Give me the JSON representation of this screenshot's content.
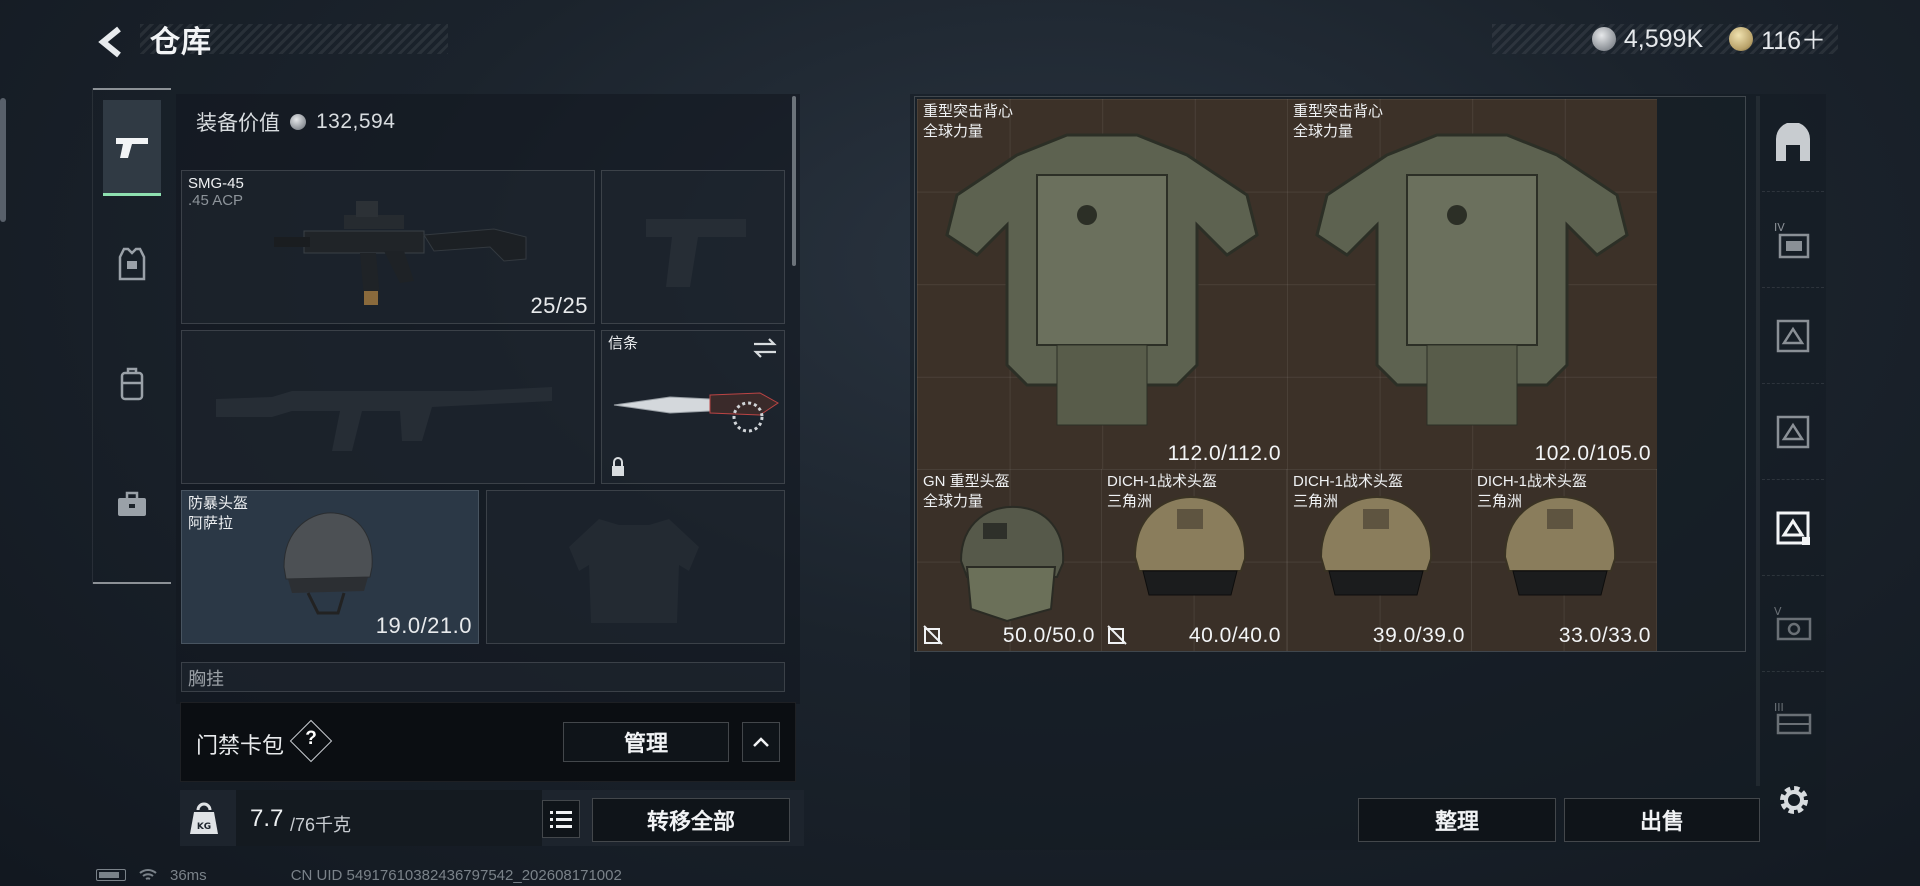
{
  "header": {
    "title": "仓库",
    "silver_amount": "4,599K",
    "gold_amount": "116＋"
  },
  "left_rail": [
    {
      "icon": "pistol-icon",
      "active": true
    },
    {
      "icon": "armor-vest-icon"
    },
    {
      "icon": "backpack-icon"
    },
    {
      "icon": "briefcase-icon"
    }
  ],
  "equipment": {
    "value_label": "装备价值",
    "value": "132,594",
    "primary_weapon": {
      "name": "SMG-45",
      "ammo": ".45 ACP",
      "count": "25/25"
    },
    "knife": {
      "name": "信条",
      "locked": true
    },
    "helmet": {
      "name": "防暴头盔",
      "sub": "阿萨拉",
      "durability": "19.0/21.0"
    },
    "next_section_label": "胸挂",
    "card_pack_label": "门禁卡包",
    "card_pack_help": "?",
    "manage_label": "管理",
    "weight_current": "7.7",
    "weight_max": "/76千克",
    "transfer_all_label": "转移全部"
  },
  "storage": {
    "items": [
      {
        "name": "重型突击背心",
        "sub": "全球力量",
        "durability": "112.0/112.0",
        "kind": "vest"
      },
      {
        "name": "重型突击背心",
        "sub": "全球力量",
        "durability": "102.0/105.0",
        "kind": "vest"
      },
      {
        "name": "GN 重型头盔",
        "sub": "全球力量",
        "durability": "50.0/50.0",
        "kind": "heavy-helmet",
        "no_insure": true
      },
      {
        "name": "DICH-1战术头盔",
        "sub": "三角洲",
        "durability": "40.0/40.0",
        "kind": "tactical-helmet",
        "no_insure": true
      },
      {
        "name": "DICH-1战术头盔",
        "sub": "三角洲",
        "durability": "39.0/39.0",
        "kind": "tactical-helmet"
      },
      {
        "name": "DICH-1战术头盔",
        "sub": "三角洲",
        "durability": "33.0/33.0",
        "kind": "tactical-helmet"
      }
    ],
    "sort_label": "整理",
    "sell_label": "出售"
  },
  "right_rail": [
    {
      "icon": "all-items-icon"
    },
    {
      "icon": "tier-iv-storage-icon",
      "tier": "IV"
    },
    {
      "icon": "storage-box-icon"
    },
    {
      "icon": "storage-box-icon"
    },
    {
      "icon": "storage-box-selected-icon",
      "active": true
    },
    {
      "icon": "tier-v-storage-icon",
      "tier": "V"
    },
    {
      "icon": "tier-iii-storage-icon",
      "tier": "III"
    }
  ],
  "status": {
    "ping": "36ms",
    "uid": "CN UID 5491761038243679754​2_202608171002"
  },
  "colors": {
    "accent_green": "#8ee0b0",
    "item_bg": "#3c3128"
  }
}
